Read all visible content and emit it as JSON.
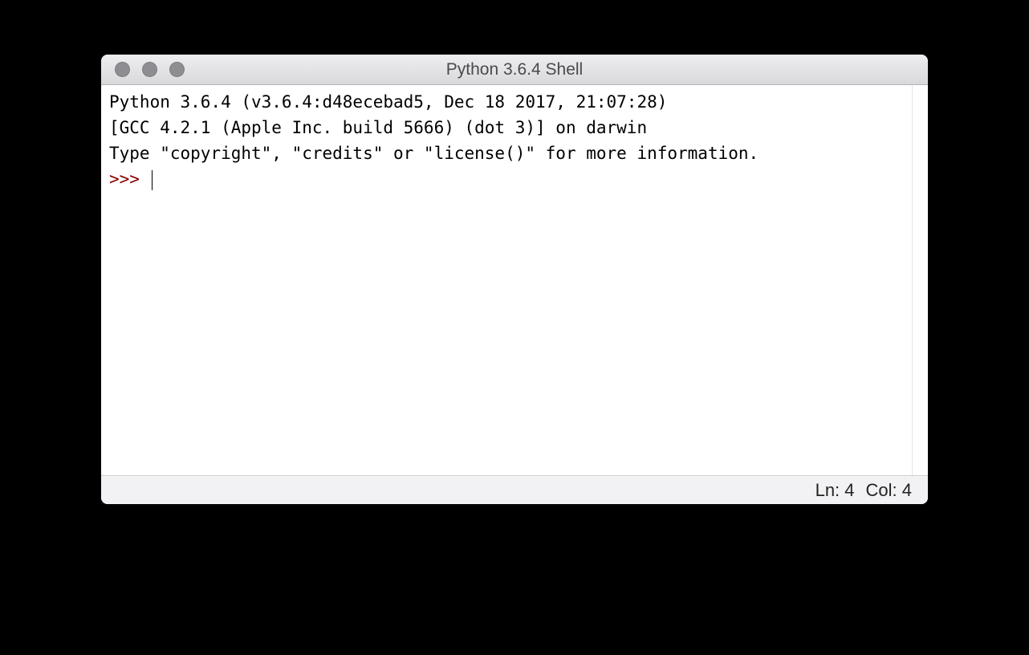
{
  "window": {
    "title": "Python 3.6.4 Shell"
  },
  "shell": {
    "line1": "Python 3.6.4 (v3.6.4:d48ecebad5, Dec 18 2017, 21:07:28) ",
    "line2": "[GCC 4.2.1 (Apple Inc. build 5666) (dot 3)] on darwin",
    "line3": "Type \"copyright\", \"credits\" or \"license()\" for more information.",
    "prompt": ">>> "
  },
  "statusbar": {
    "line_label": "Ln: 4",
    "col_label": "Col: 4"
  }
}
